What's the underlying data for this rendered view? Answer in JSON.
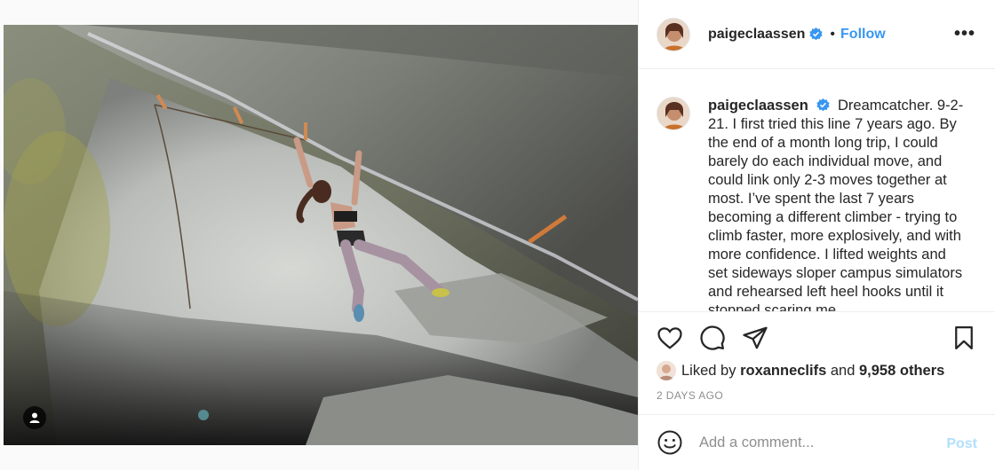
{
  "post": {
    "username": "paigeclaassen",
    "follow_label": "Follow",
    "separator": "•",
    "more_label": "•••",
    "caption": "Dreamcatcher. 9-2-21. I first tried this line 7 years ago. By the end of a month long trip, I could barely do each individual move, and could link only 2-3 moves together at most. I’ve spent the last 7 years becoming a different climber - trying to climb faster, more explosively, and with more confidence. I lifted weights and set sideways sloper campus simulators and rehearsed left heel hooks until it stopped scaring me.",
    "likes": {
      "prefix": "Liked by",
      "user": "roxanneclifs",
      "middle": "and",
      "others": "9,958 others"
    },
    "time": "2 DAYS AGO"
  },
  "comment": {
    "placeholder": "Add a comment...",
    "post_label": "Post"
  },
  "icons": {
    "verified": "verified-badge-icon",
    "like": "heart-icon",
    "comment": "comment-bubble-icon",
    "share": "paper-plane-icon",
    "save": "bookmark-icon",
    "emoji": "smiley-icon",
    "tag": "user-tag-icon"
  },
  "colors": {
    "accent": "#3897f0",
    "verified": "#3897f0",
    "post_disabled": "#b2dffc",
    "muted": "#8e8e8e"
  }
}
